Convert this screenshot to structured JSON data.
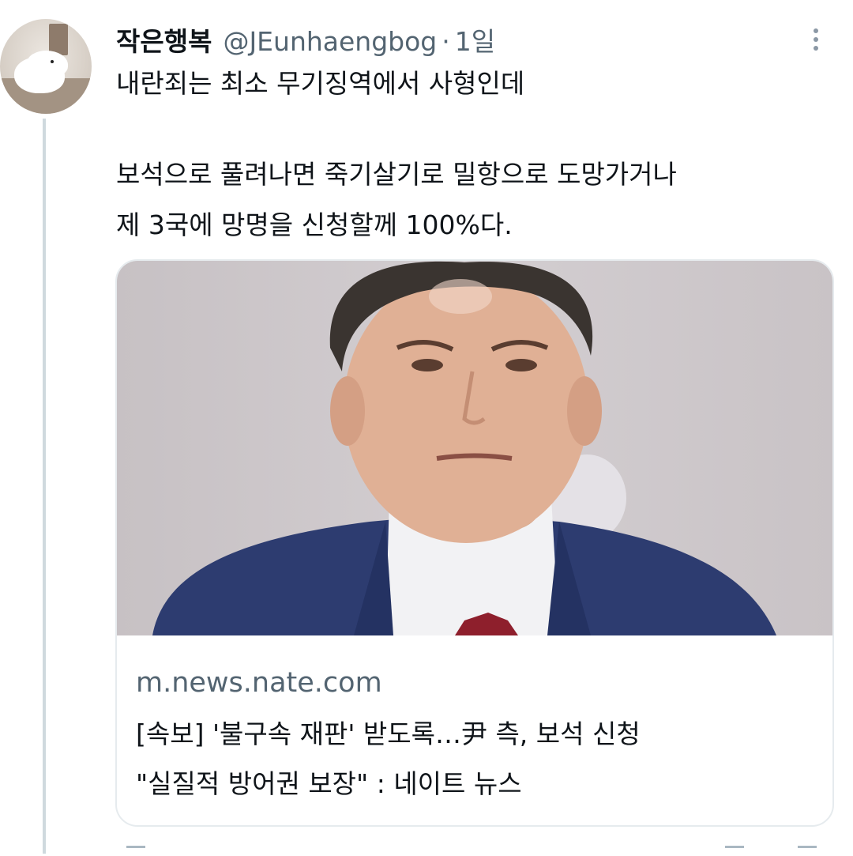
{
  "tweet": {
    "author_name": "작은행복",
    "handle": "@JEunhaengbog",
    "separator": "·",
    "time": "1일",
    "lines": [
      "내란죄는 최소 무기징역에서 사형인데",
      "보석으로 풀려나면 죽기살기로 밀항으로 도망가거나",
      "제 3국에 망명을 신청할께 100%다."
    ]
  },
  "link_card": {
    "domain": "m.news.nate.com",
    "title_lines": [
      "[속보] '불구속 재판' 받도록…尹 측, 보석 신청",
      "\"실질적 방어권 보장\" : 네이트 뉴스"
    ]
  },
  "icons": {
    "more": "more-vertical-icon",
    "avatar": "profile-photo-dog"
  },
  "colors": {
    "text": "#0f1419",
    "secondary": "#536471",
    "border": "#e6ebee",
    "thread_line": "#cfd9de"
  }
}
